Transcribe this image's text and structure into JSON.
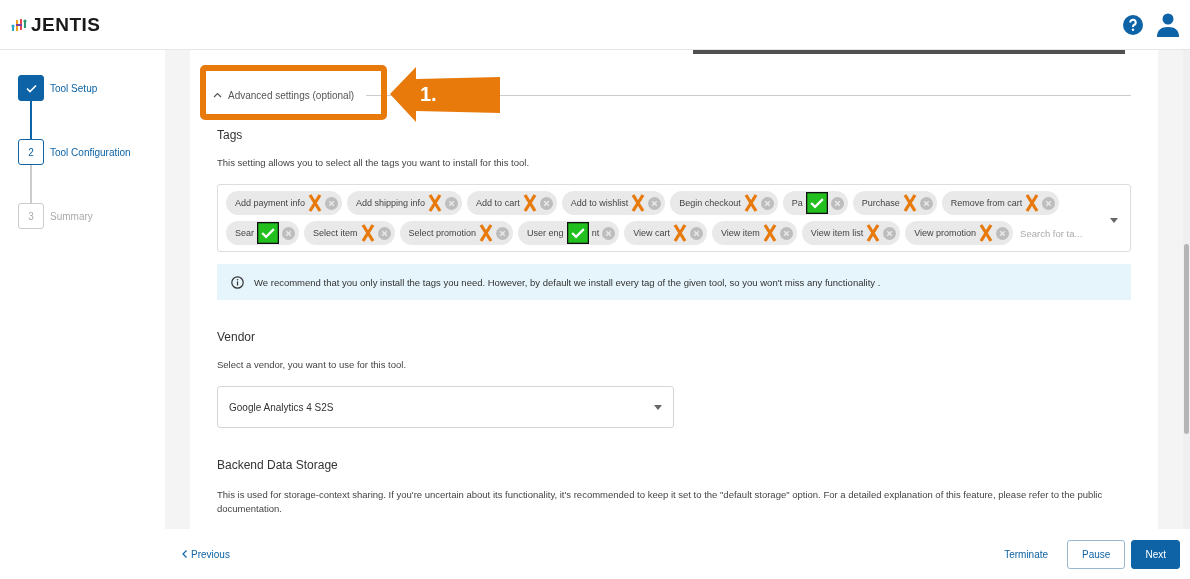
{
  "header": {
    "logo": "JENTIS"
  },
  "steps": [
    {
      "label": "Tool Setup",
      "completed": true,
      "active": true
    },
    {
      "number": "2",
      "label": "Tool Configuration",
      "completed": false,
      "active": true
    },
    {
      "number": "3",
      "label": "Summary",
      "completed": false,
      "active": false
    }
  ],
  "advanced_toggle": {
    "label": "Advanced settings (optional)",
    "expanded": true
  },
  "annotation": {
    "label": "1."
  },
  "tags_section": {
    "title": "Tags",
    "description": "This setting allows you to select all the tags you want to install for this tool.",
    "tags": [
      {
        "label": "Add payment info",
        "checked": false
      },
      {
        "label": "Add shipping info",
        "checked": false
      },
      {
        "label": "Add to cart",
        "checked": false
      },
      {
        "label": "Add to wishlist",
        "checked": false
      },
      {
        "label": "Begin checkout",
        "checked": false
      },
      {
        "label": "Pa",
        "checked": true
      },
      {
        "label": "Purchase",
        "checked": false
      },
      {
        "label": "Remove from cart",
        "checked": false
      },
      {
        "label": "Sear",
        "checked": true
      },
      {
        "label": "Select item",
        "checked": false
      },
      {
        "label": "Select promotion",
        "checked": false
      },
      {
        "label": "User eng",
        "checked": true,
        "label_after": "nt"
      },
      {
        "label": "View cart",
        "checked": false
      },
      {
        "label": "View item",
        "checked": false
      },
      {
        "label": "View item list",
        "checked": false
      },
      {
        "label": "View promotion",
        "checked": false
      }
    ],
    "search": {
      "placeholder": "Search for ta..."
    },
    "info": "We recommend that you only install the tags you need. However, by default we install every tag of the given tool, so you won't miss any functionality ."
  },
  "vendor_section": {
    "title": "Vendor",
    "description": "Select a vendor, you want to use for this tool.",
    "value": "Google Analytics 4 S2S"
  },
  "storage_section": {
    "title": "Backend Data Storage",
    "description": "This is used for storage-context sharing. If you're uncertain about its functionality, it's recommended to keep it set to the \"default storage\" option. For a detailed explanation of this feature, please refer to the public documentation."
  },
  "footer": {
    "previous": "Previous",
    "terminate": "Terminate",
    "pause": "Pause",
    "next": "Next"
  }
}
